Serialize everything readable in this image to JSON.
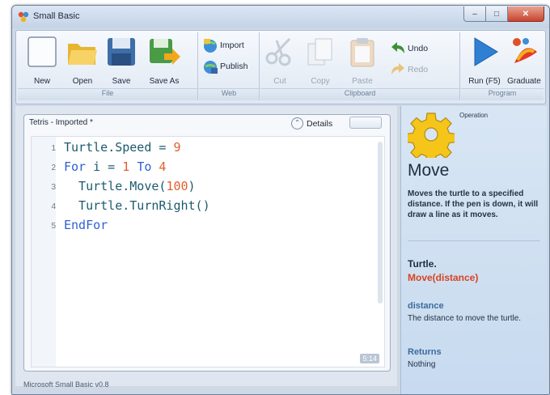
{
  "window": {
    "title": "Small Basic",
    "status": "Microsoft Small Basic v0.8"
  },
  "ribbon": {
    "file": {
      "label": "File",
      "new": "New",
      "open": "Open",
      "save": "Save",
      "save_as": "Save As"
    },
    "web": {
      "label": "Web",
      "import": "Import",
      "publish": "Publish"
    },
    "clipboard": {
      "label": "Clipboard",
      "cut": "Cut",
      "copy": "Copy",
      "paste": "Paste",
      "undo": "Undo",
      "redo": "Redo"
    },
    "program": {
      "label": "Program",
      "run": "Run (F5)",
      "graduate": "Graduate"
    }
  },
  "editor": {
    "doc_title": "Tetris - Imported *",
    "details_label": "Details",
    "position": "5:14",
    "lines": [
      {
        "n": "1",
        "tokens": [
          {
            "t": "Turtle",
            "c": "id"
          },
          {
            "t": ".",
            "c": "op"
          },
          {
            "t": "Speed",
            "c": "id"
          },
          {
            "t": " = ",
            "c": "op"
          },
          {
            "t": "9",
            "c": "num"
          }
        ]
      },
      {
        "n": "2",
        "tokens": [
          {
            "t": "For",
            "c": "kw"
          },
          {
            "t": " i = ",
            "c": "op"
          },
          {
            "t": "1",
            "c": "num"
          },
          {
            "t": " ",
            "c": "op"
          },
          {
            "t": "To",
            "c": "kw"
          },
          {
            "t": " ",
            "c": "op"
          },
          {
            "t": "4",
            "c": "num"
          }
        ]
      },
      {
        "n": "3",
        "tokens": [
          {
            "t": "  Turtle",
            "c": "id"
          },
          {
            "t": ".",
            "c": "op"
          },
          {
            "t": "Move(",
            "c": "id"
          },
          {
            "t": "100",
            "c": "num"
          },
          {
            "t": ")",
            "c": "op"
          }
        ]
      },
      {
        "n": "4",
        "tokens": [
          {
            "t": "  Turtle",
            "c": "id"
          },
          {
            "t": ".",
            "c": "op"
          },
          {
            "t": "TurnRight()",
            "c": "id"
          }
        ]
      },
      {
        "n": "5",
        "tokens": [
          {
            "t": "EndFor",
            "c": "kw"
          }
        ]
      }
    ]
  },
  "help": {
    "kind": "Operation",
    "title": "Move",
    "description": "Moves the turtle to a specified distance.  If the pen is down, it will draw a line as it moves.",
    "object": "Turtle.",
    "signature": "Move(distance)",
    "param_name": "distance",
    "param_desc": "The distance to move the turtle.",
    "returns_label": "Returns",
    "returns_value": "Nothing"
  },
  "colors": {
    "keyword": "#2f5fd4",
    "number": "#e25e2e",
    "identifier": "#1c5a6e",
    "signature": "#d8431f",
    "accent": "#3d6b9c"
  }
}
